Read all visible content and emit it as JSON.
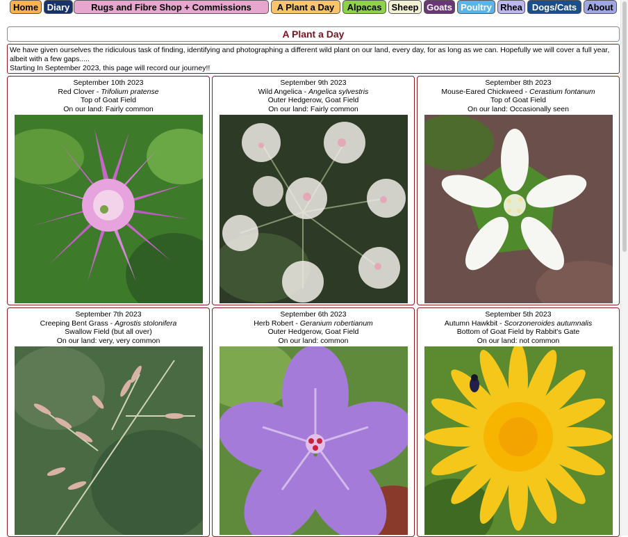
{
  "nav": {
    "items": [
      {
        "label": "Home",
        "bg": "#f9b251",
        "fg": "#000000"
      },
      {
        "label": "Diary",
        "bg": "#17326a",
        "fg": "#ffffff"
      },
      {
        "label": "Rugs and Fibre Shop + Commissions",
        "bg": "#e8a6cf",
        "fg": "#000000"
      },
      {
        "label": "A Plant a Day",
        "bg": "#f9c46a",
        "fg": "#000000"
      },
      {
        "label": "Alpacas",
        "bg": "#8fd14a",
        "fg": "#000000"
      },
      {
        "label": "Sheep",
        "bg": "#f2f0d2",
        "fg": "#000000"
      },
      {
        "label": "Goats",
        "bg": "#6b3676",
        "fg": "#ffffff"
      },
      {
        "label": "Poultry",
        "bg": "#5bb3e8",
        "fg": "#ffffff"
      },
      {
        "label": "Rhea",
        "bg": "#bcb8ee",
        "fg": "#000000"
      },
      {
        "label": "Dogs/Cats",
        "bg": "#1a4f8b",
        "fg": "#ffffff"
      },
      {
        "label": "About",
        "bg": "#9fa6e6",
        "fg": "#000000"
      }
    ]
  },
  "page": {
    "title": "A Plant a Day",
    "intro_line1": "We have given ourselves the ridiculous task of finding, identifying and photographing a different wild plant on our land, every day, for as long as we can. Hopefully we will cover a full year, albeit with a few gaps.....",
    "intro_line2": "Starting In September 2023, this page will record our journey!!"
  },
  "plants": [
    {
      "date": "September 10th 2023",
      "common": "Red Clover",
      "latin": "Trifolium pratense",
      "location": "Top of Goat Field",
      "land": "On our land: Fairly common",
      "photo": "red-clover"
    },
    {
      "date": "September 9th 2023",
      "common": "Wild Angelica",
      "latin": "Angelica sylvestris",
      "location": "Outer Hedgerow, Goat Field",
      "land": "On our land: Fairly common",
      "photo": "wild-angelica"
    },
    {
      "date": "September 8th 2023",
      "common": "Mouse-Eared Chickweed",
      "latin": "Cerastium fontanum",
      "location": "Top of Goat Field",
      "land": "On our land: Occasionally seen",
      "photo": "chickweed"
    },
    {
      "date": "September 7th 2023",
      "common": "Creeping Bent Grass",
      "latin": "Agrostis stolonifera",
      "location": "Swallow Field (but all over)",
      "land": "On our land: very, very common",
      "photo": "bent-grass"
    },
    {
      "date": "September 6th 2023",
      "common": "Herb Robert",
      "latin": "Geranium robertianum",
      "location": "Outer Hedgerow, Goat Field",
      "land": "On our land: common",
      "photo": "herb-robert"
    },
    {
      "date": "September 5th 2023",
      "common": "Autumn Hawkbit",
      "latin": "Scorzoneroides autumnalis",
      "location": "Bottom of Goat Field by Rabbit's Gate",
      "land": "On our land: not common",
      "photo": "hawkbit"
    }
  ]
}
